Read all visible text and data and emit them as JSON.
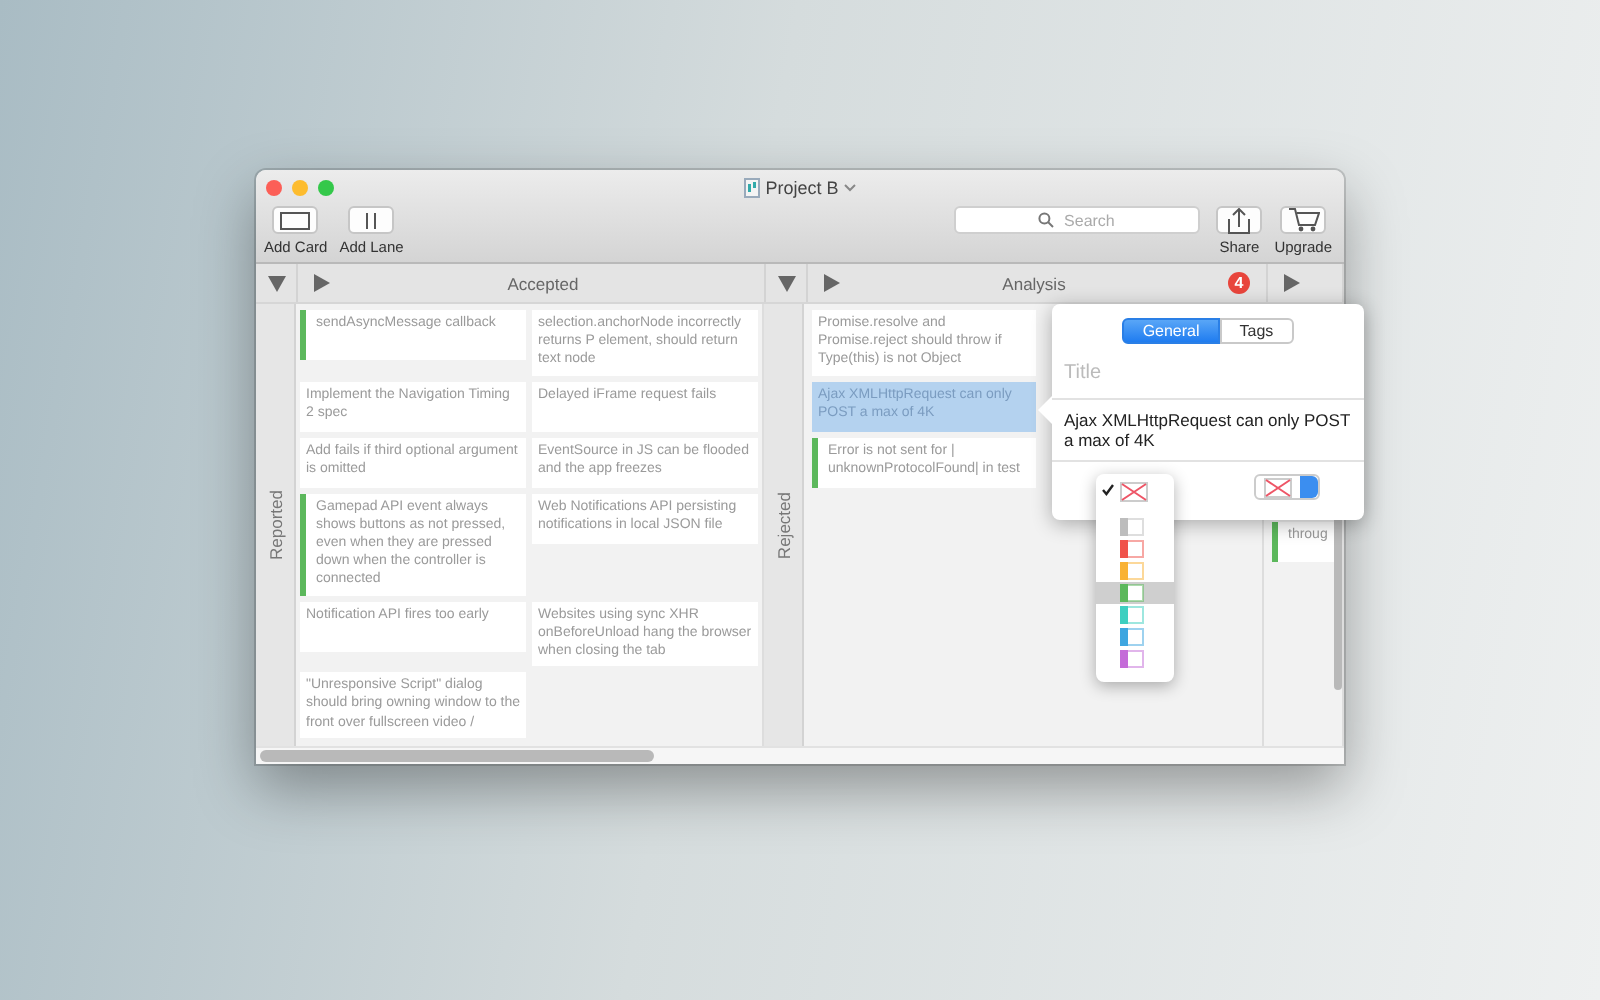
{
  "window": {
    "title": "Project B"
  },
  "toolbar": {
    "left": [
      {
        "label": "Add Card",
        "kind": "card"
      },
      {
        "label": "Add Lane",
        "kind": "lane"
      }
    ],
    "search": {
      "placeholder": "Search"
    },
    "right": [
      {
        "label": "Share",
        "kind": "share"
      },
      {
        "label": "Upgrade",
        "kind": "cart"
      }
    ]
  },
  "lanes": [
    {
      "title": "Accepted",
      "group": "Reported",
      "cards": [
        {
          "text": "sendAsyncMessage callback",
          "color": "#5cb85c",
          "selected": false
        },
        {
          "text": "selection.anchorNode incorrectly returns P element, should return text node",
          "selected": false
        },
        {
          "text": "Implement the Navigation Timing 2 spec",
          "selected": false
        },
        {
          "text": "Delayed iFrame request fails",
          "selected": false
        },
        {
          "text": "Add fails if third optional argument is omitted",
          "selected": false
        },
        {
          "text": "EventSource in JS can be flooded and the app freezes",
          "selected": false
        },
        {
          "text": "Gamepad API event always shows buttons as not pressed, even when they are pressed down when the controller is connected",
          "color": "#5cb85c",
          "selected": false
        },
        {
          "text": "Web Notifications API persisting notifications in local JSON file",
          "selected": false
        },
        {
          "text": "Notification API fires too early",
          "selected": false
        },
        {
          "text": "Websites using sync XHR onBeforeUnload hang the browser when closing the tab",
          "selected": false
        },
        {
          "text": "\"Unresponsive Script\" dialog should bring owning window to the front over fullscreen video /",
          "selected": false
        }
      ]
    },
    {
      "title": "Analysis",
      "badge": "4",
      "group": "Rejected",
      "cards": [
        {
          "text": "Promise.resolve and Promise.reject should throw if Type(this) is not Object",
          "selected": false
        },
        {
          "text": "Ajax XMLHttpRequest can only POST a max of 4K",
          "selected": true
        },
        {
          "text": "Error is not sent for | unknownProtocolFound| in test",
          "color": "#5cb85c",
          "selected": false
        }
      ]
    },
    {
      "cards": [
        {
          "text": "throug",
          "color": "#5cb85c",
          "selected": false
        }
      ]
    }
  ],
  "popover": {
    "tabs": [
      {
        "label": "General",
        "selected": true
      },
      {
        "label": "Tags",
        "selected": false
      }
    ],
    "title_placeholder": "Title",
    "text": "Ajax XMLHttpRequest can only POST a max of 4K",
    "color_menu": [
      {
        "kind": "none",
        "checked": true,
        "highlighted": false
      },
      {
        "kind": "color",
        "color": "#bdbdbd",
        "checked": false,
        "highlighted": false
      },
      {
        "kind": "color",
        "color": "#f0524a",
        "checked": false,
        "highlighted": false
      },
      {
        "kind": "color",
        "color": "#f9b234",
        "checked": false,
        "highlighted": false
      },
      {
        "kind": "color",
        "color": "#5cb85c",
        "checked": false,
        "highlighted": true
      },
      {
        "kind": "color",
        "color": "#3ecfc0",
        "checked": false,
        "highlighted": false
      },
      {
        "kind": "color",
        "color": "#3ea6e0",
        "checked": false,
        "highlighted": false
      },
      {
        "kind": "color",
        "color": "#c46bd8",
        "checked": false,
        "highlighted": false
      }
    ]
  }
}
